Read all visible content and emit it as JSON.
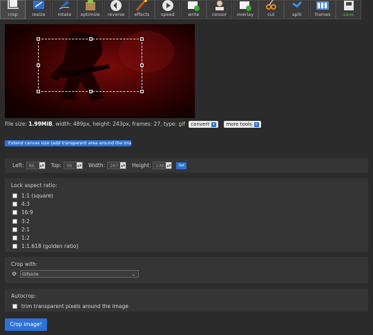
{
  "toolbar": {
    "tools": [
      {
        "label": "crop",
        "icon": "crop-icon",
        "active": true
      },
      {
        "label": "resize",
        "icon": "resize-icon"
      },
      {
        "label": "rotate",
        "icon": "rotate-icon"
      },
      {
        "label": "optimize",
        "icon": "optimize-icon"
      },
      {
        "label": "reverse",
        "icon": "reverse-icon"
      },
      {
        "label": "effects",
        "icon": "effects-icon"
      },
      {
        "label": "speed",
        "icon": "speed-icon"
      },
      {
        "label": "write",
        "icon": "write-icon"
      },
      {
        "label": "censor",
        "icon": "censor-icon"
      },
      {
        "label": "overlay",
        "icon": "overlay-icon"
      },
      {
        "label": "cut",
        "icon": "scissors-icon"
      },
      {
        "label": "split",
        "icon": "split-icon"
      },
      {
        "label": "frames",
        "icon": "frames-icon"
      },
      {
        "label": "save",
        "icon": "save-icon",
        "accent": "#3fbf3f"
      }
    ]
  },
  "fileinfo": {
    "prefix": "File size:",
    "size": "1.99MiB",
    "rest": ", width: 489px, height: 243px, frames: 27, type: gif",
    "convert_label": "convert",
    "more_tools_label": "more tools"
  },
  "extend_button": "Extend canvas size (add transparent area around the image)",
  "coords": {
    "left_label": "Left:",
    "left_value": "86",
    "top_label": "Top:",
    "top_value": "38",
    "width_label": "Width:",
    "width_value": "267",
    "height_label": "Height:",
    "height_value": "138",
    "set_label": "Set"
  },
  "aspect": {
    "title": "Lock aspect ratio:",
    "options": [
      "1:1 (square)",
      "4:3",
      "16:9",
      "3:2",
      "2:1",
      "1:2",
      "1:1.618 (golden ratio)"
    ]
  },
  "crop_with": {
    "title": "Crop with:",
    "selected": "Gifsicle"
  },
  "autocrop": {
    "title": "Autocrop:",
    "option": "trim transparent pixels around the image"
  },
  "crop_button": "Crop image!",
  "colors": {
    "accent": "#2c72d6",
    "save_green": "#3fbf3f",
    "background": "#2b2b2b",
    "panel": "#353535"
  }
}
